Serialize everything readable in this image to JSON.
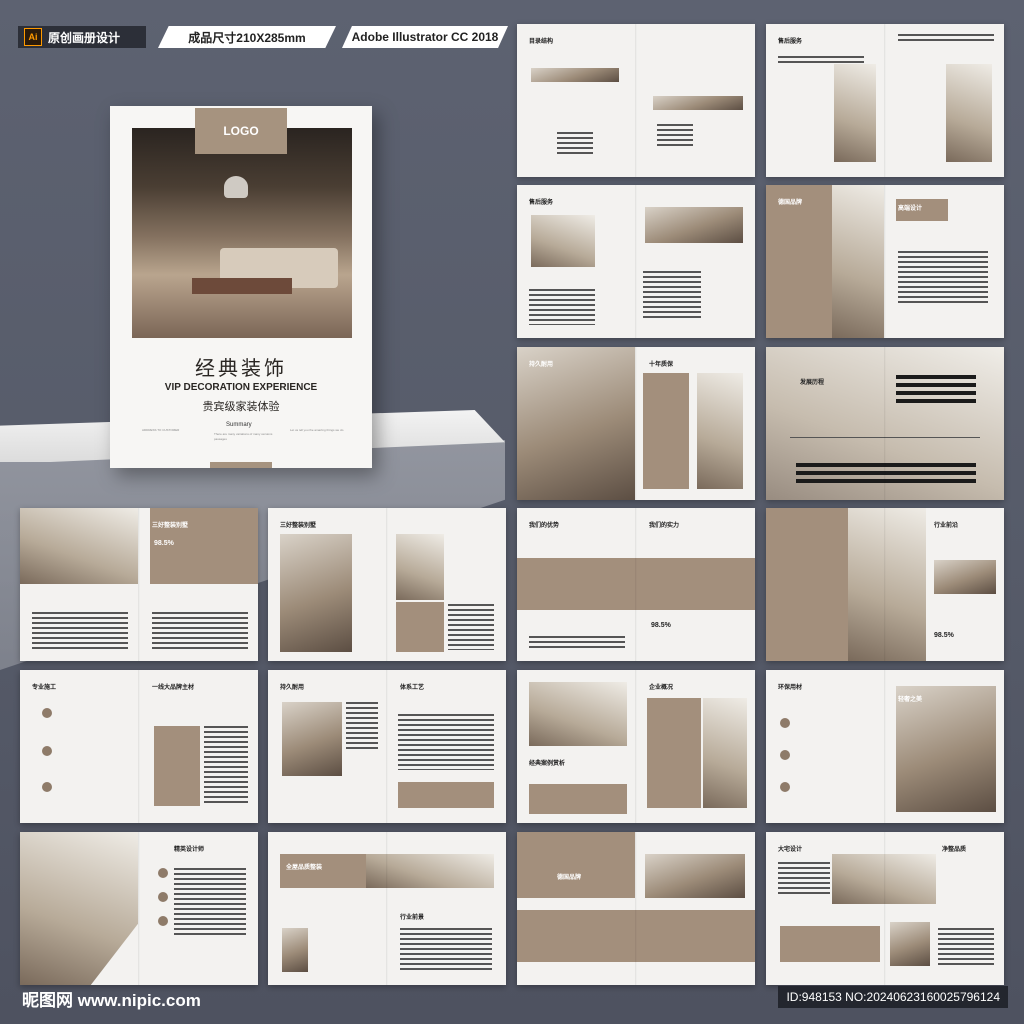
{
  "header": {
    "tag1_icon": "Ai",
    "tag1": "原创画册设计",
    "tag2": "成品尺寸210X285mm",
    "tag3": "Adobe Illustrator CC 2018"
  },
  "cover": {
    "logo": "LOGO",
    "title_cn": "经典装饰",
    "title_en": "VIP DECORATION EXPERIENCE",
    "subtitle_cn": "贵宾级家装体验",
    "summary_label": "Summary",
    "fine_left": "ADDRESS TO CUSTOMER",
    "fine_mid": "There are many variations of many versions passages",
    "fine_right": "Let us tell you the amazing things we do"
  },
  "spreads": [
    {
      "id": "s1",
      "left": "目录结构",
      "right": ""
    },
    {
      "id": "s2",
      "left": "售后服务",
      "right": ""
    },
    {
      "id": "s3",
      "left": "售后服务",
      "right": ""
    },
    {
      "id": "s4",
      "left": "德国品牌",
      "right": "高端设计"
    },
    {
      "id": "s5",
      "left": "持久耐用",
      "right": "十年质保"
    },
    {
      "id": "s6",
      "left": "发展历程",
      "right": ""
    },
    {
      "id": "s7",
      "left": "",
      "right": "三好整装别墅",
      "pct": "98.5%"
    },
    {
      "id": "s8",
      "left": "三好整装别墅",
      "right": ""
    },
    {
      "id": "s9",
      "left": "我们的优势",
      "right": "我们的实力",
      "pct": "98.5%"
    },
    {
      "id": "s10",
      "left": "",
      "right": "行业前沿",
      "pct": "98.5%"
    },
    {
      "id": "s11",
      "left": "专业施工",
      "right": "一线大品牌主材"
    },
    {
      "id": "s12",
      "left": "持久耐用",
      "right": "体系工艺"
    },
    {
      "id": "s13",
      "left": "经典案例赏析",
      "right": "企业概况"
    },
    {
      "id": "s14",
      "left": "环保用材",
      "right": "轻奢之美"
    },
    {
      "id": "s15",
      "left": "",
      "right": "精英设计师"
    },
    {
      "id": "s16",
      "left": "全屋品质整装",
      "right": "行业前景"
    },
    {
      "id": "s17",
      "left": "德国品牌",
      "right": ""
    },
    {
      "id": "s18",
      "left": "大宅设计",
      "right": "净整品质"
    }
  ],
  "footer": {
    "left": "昵图网 www.nipic.com",
    "right": "ID:948153 NO:20240623160025796124"
  }
}
